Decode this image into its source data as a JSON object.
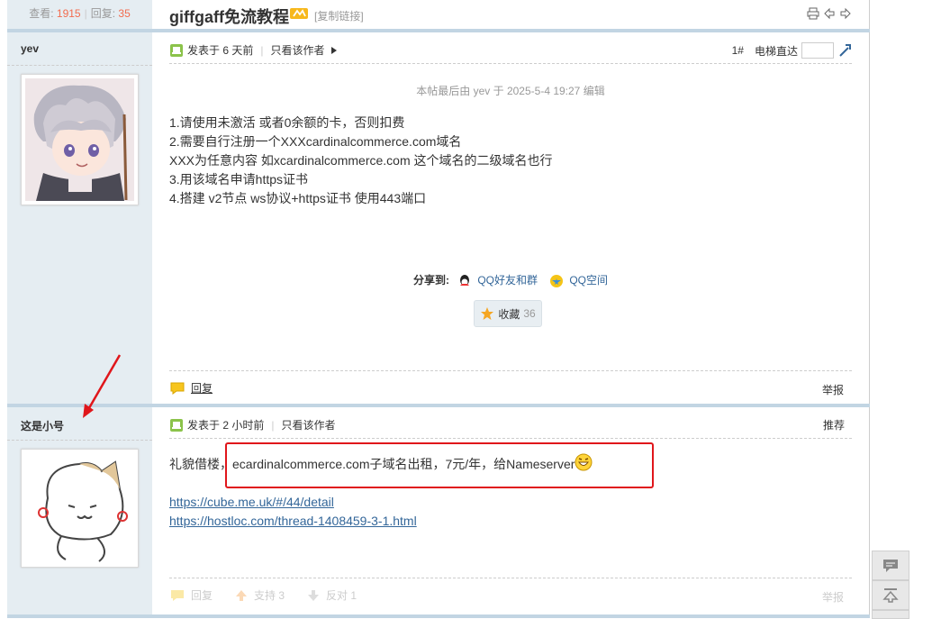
{
  "stats": {
    "views_label": "查看:",
    "views": "1915",
    "replies_label": "回复:",
    "replies": "35"
  },
  "thread": {
    "title": "giffgaff免流教程",
    "copy_link": "[复制链接]"
  },
  "post1": {
    "author": "yev",
    "posted": "发表于 6 天前",
    "only_author": "只看该作者",
    "floor": "1#",
    "elevator": "电梯直达",
    "edit_note": "本帖最后由 yev 于 2025-5-4 19:27 编辑",
    "lines": [
      "1.请使用未激活 或者0余额的卡，否则扣费",
      "2.需要自行注册一个XXXcardinalcommerce.com域名",
      "XXX为任意内容 如xcardinalcommerce.com 这个域名的二级域名也行",
      "3.用该域名申请https证书",
      "4.搭建 v2节点 ws协议+https证书 使用443端口"
    ],
    "share_label": "分享到:",
    "share_qq": "QQ好友和群",
    "share_qzone": "QQ空间",
    "fav_label": "收藏",
    "fav_count": "36",
    "reply": "回复",
    "report": "举报"
  },
  "post2": {
    "author": "这是小号",
    "posted": "发表于 2 小时前",
    "only_author": "只看该作者",
    "recommend": "推荐",
    "text_prefix": "礼貌借楼，",
    "text_main": "ecardinalcommerce.com子域名出租，7元/年，给Nameserver",
    "link1": "https://cube.me.uk/#/44/detail",
    "link2": "https://hostloc.com/thread-1408459-3-1.html",
    "reply": "回复",
    "support": "支持 3",
    "oppose": "反对 1",
    "report": "举报"
  },
  "colors": {
    "accent_red": "#e0161b",
    "link": "#336699",
    "sidebar": "#e5edf2",
    "count": "#f26c4f"
  }
}
